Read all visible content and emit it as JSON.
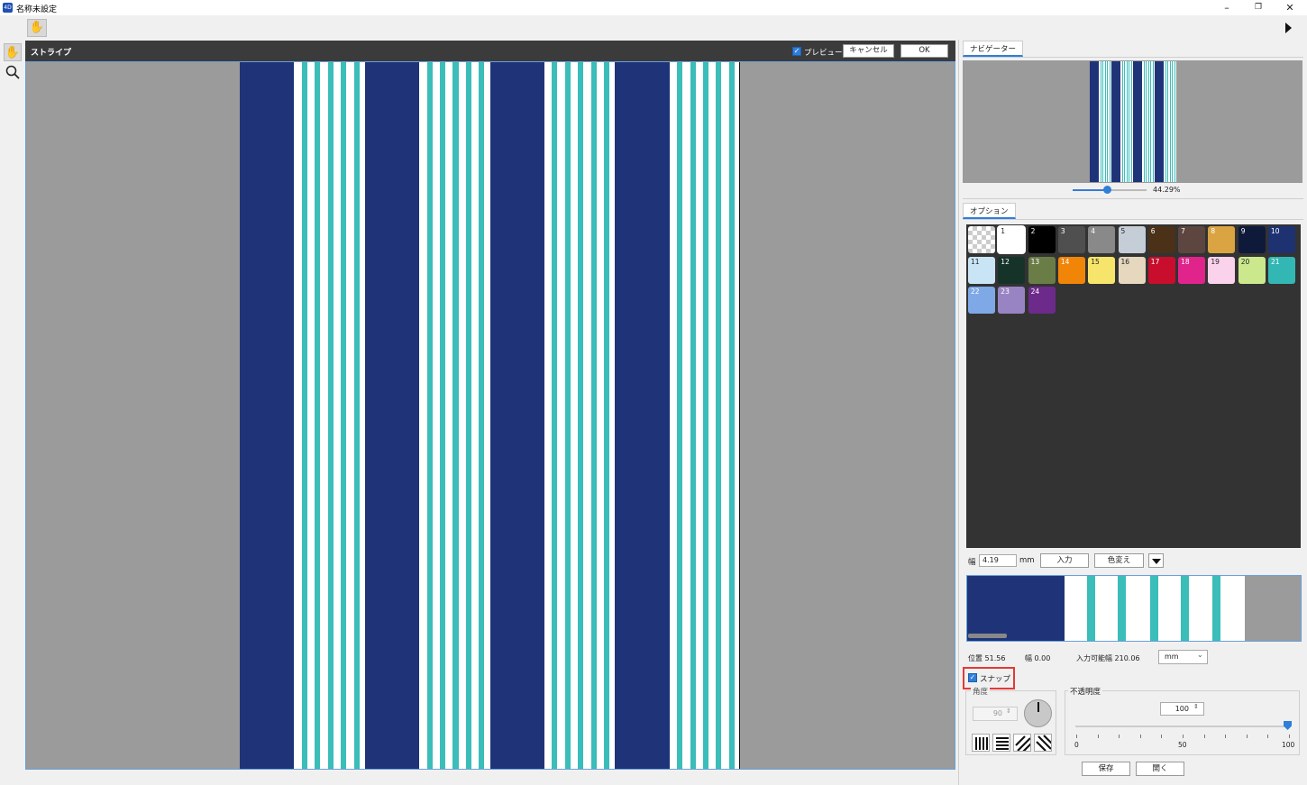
{
  "window": {
    "title": "名称未設定",
    "app_icon": "app-icon"
  },
  "toolbar": {
    "tool": "hand-icon"
  },
  "panel": {
    "title": "ストライプ",
    "preview_label": "プレビュー",
    "preview_checked": true,
    "cancel_label": "キャンセル",
    "ok_label": "OK"
  },
  "stripe_colors": {
    "navy": "#1f3478",
    "teal": "#3bbdb9",
    "white": "#ffffff",
    "gray": "#9b9b9b"
  },
  "navigator": {
    "tab_label": "ナビゲーター",
    "zoom": "44.29%"
  },
  "options": {
    "tab_label": "オプション",
    "swatches": [
      {
        "num": "",
        "color": "transparent"
      },
      {
        "num": "1",
        "color": "#ffffff"
      },
      {
        "num": "2",
        "color": "#000000"
      },
      {
        "num": "3",
        "color": "#4f4f4f"
      },
      {
        "num": "4",
        "color": "#898989"
      },
      {
        "num": "5",
        "color": "#c5ced6"
      },
      {
        "num": "6",
        "color": "#4a3117"
      },
      {
        "num": "7",
        "color": "#5d4640"
      },
      {
        "num": "8",
        "color": "#d9a441"
      },
      {
        "num": "9",
        "color": "#0f1a3a"
      },
      {
        "num": "10",
        "color": "#1e3272"
      },
      {
        "num": "11",
        "color": "#c9e4f5"
      },
      {
        "num": "12",
        "color": "#16332a"
      },
      {
        "num": "13",
        "color": "#6b7d47"
      },
      {
        "num": "14",
        "color": "#f18508"
      },
      {
        "num": "15",
        "color": "#f7e46a"
      },
      {
        "num": "16",
        "color": "#e6d7bf"
      },
      {
        "num": "17",
        "color": "#c80e2c"
      },
      {
        "num": "18",
        "color": "#e1248b"
      },
      {
        "num": "19",
        "color": "#fad2ec"
      },
      {
        "num": "20",
        "color": "#cbe88d"
      },
      {
        "num": "21",
        "color": "#33b7b4"
      },
      {
        "num": "22",
        "color": "#7ea9e6"
      },
      {
        "num": "23",
        "color": "#9884c3"
      },
      {
        "num": "24",
        "color": "#6c2a8a"
      }
    ],
    "width_label": "幅",
    "width_value": "4.19",
    "width_unit": "mm",
    "input_button": "入力",
    "recolor_button": "色変え",
    "position": "位置 51.56",
    "width_info": "幅 0.00",
    "available": "入力可能幅 210.06",
    "unit_option": "mm",
    "snap_label": "スナップ",
    "snap_checked": true,
    "angle_label": "角度",
    "angle_value": "90",
    "opacity_label": "不透明度",
    "opacity_value": "100",
    "opacity_percent": 100,
    "scale_min": "0",
    "scale_mid": "50",
    "scale_max": "100",
    "save_button": "保存",
    "open_button": "開く"
  }
}
